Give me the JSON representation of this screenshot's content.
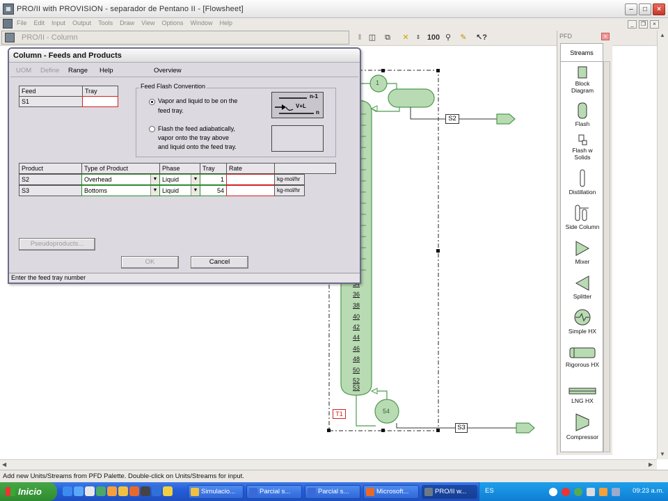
{
  "window": {
    "title": "PRO/II with PROVISION - separador de Pentano II - [Flowsheet]",
    "icon": "proii-app-icon",
    "controls": [
      "minimize",
      "maximize",
      "close"
    ]
  },
  "menubar": {
    "items": [
      "File",
      "Edit",
      "Input",
      "Output",
      "Tools",
      "Draw",
      "View",
      "Options",
      "Window",
      "Help"
    ]
  },
  "toolbar": {
    "column_window_title": "PRO/II - Column",
    "zoom_label": "100",
    "icons": [
      "pause-icon",
      "camera-icon",
      "copy-icon",
      "up-down-arrow-icon",
      "run-icon",
      "zoom-100-icon",
      "magnifier-icon",
      "pencil-icon",
      "help-pointer-icon"
    ]
  },
  "dialog": {
    "title": "Column - Feeds and Products",
    "menu": {
      "uom": "UOM",
      "define": "Define",
      "range": "Range",
      "help": "Help",
      "overview": "Overview"
    },
    "feed_table": {
      "headers": [
        "Feed",
        "Tray"
      ],
      "rows": [
        {
          "feed": "S1",
          "tray": ""
        }
      ]
    },
    "feed_flash": {
      "title": "Feed Flash Convention",
      "option1_line1": "Vapor and liquid to be on the",
      "option1_line2": "feed tray.",
      "option2_line1": "Flash the feed adiabatically,",
      "option2_line2": "vapor onto the tray above",
      "option2_line3": "and liquid onto the feed tray.",
      "selected": 1,
      "diagram_label_top": "n-1",
      "diagram_label_mid": "V+L",
      "diagram_label_bottom": "n"
    },
    "product_table": {
      "headers": [
        "Product",
        "Type of Product",
        "Phase",
        "Tray",
        "Rate"
      ],
      "rows": [
        {
          "product": "S2",
          "type": "Overhead",
          "phase": "Liquid",
          "tray": "1",
          "rate": "",
          "units": "kg-mol/hr"
        },
        {
          "product": "S3",
          "type": "Bottoms",
          "phase": "Liquid",
          "tray": "54",
          "rate": "",
          "units": "kg-mol/hr"
        }
      ]
    },
    "pseudoproducts_button": "Pseudoproducts...",
    "ok_button": "OK",
    "cancel_button": "Cancel",
    "status": "Enter the feed tray number"
  },
  "flowsheet": {
    "column_label": "T1",
    "condenser_label": "1",
    "reboiler_label": "54",
    "overhead_stream": "S2",
    "bottoms_stream": "S3",
    "tray_labels": [
      "34",
      "36",
      "38",
      "40",
      "42",
      "44",
      "46",
      "48",
      "50",
      "52",
      "53"
    ],
    "accent_green": "#b9dbb3",
    "outline_green": "#4d9a4d"
  },
  "palette": {
    "title": "PFD",
    "active_tab": "Streams",
    "items": [
      {
        "line1": "Block",
        "line2": "Diagram",
        "icon": "block-diagram-icon"
      },
      {
        "line1": "Flash",
        "line2": "",
        "icon": "flash-drum-icon"
      },
      {
        "line1": "Flash w",
        "line2": "Solids",
        "icon": "flash-solids-icon"
      },
      {
        "line1": "Distillation",
        "line2": "",
        "icon": "distillation-icon"
      },
      {
        "line1": "Side Column",
        "line2": "",
        "icon": "side-column-icon"
      },
      {
        "line1": "Mixer",
        "line2": "",
        "icon": "mixer-icon"
      },
      {
        "line1": "Splitter",
        "line2": "",
        "icon": "splitter-icon"
      },
      {
        "line1": "Simple HX",
        "line2": "",
        "icon": "simple-hx-icon"
      },
      {
        "line1": "Rigorous HX",
        "line2": "",
        "icon": "rigorous-hx-icon"
      },
      {
        "line1": "LNG HX",
        "line2": "",
        "icon": "lng-hx-icon"
      },
      {
        "line1": "Compressor",
        "line2": "",
        "icon": "compressor-icon"
      }
    ]
  },
  "statusbar": {
    "text": "Add new Units/Streams from PFD Palette.  Double-click on Units/Streams for input."
  },
  "taskbar": {
    "start_label": "Inicio",
    "tasks": [
      "Simulacio...",
      "Parcial s...",
      "Parcial s...",
      "Microsoft...",
      "PRO/II w..."
    ],
    "language": "ES",
    "clock": "09:23 a.m."
  }
}
